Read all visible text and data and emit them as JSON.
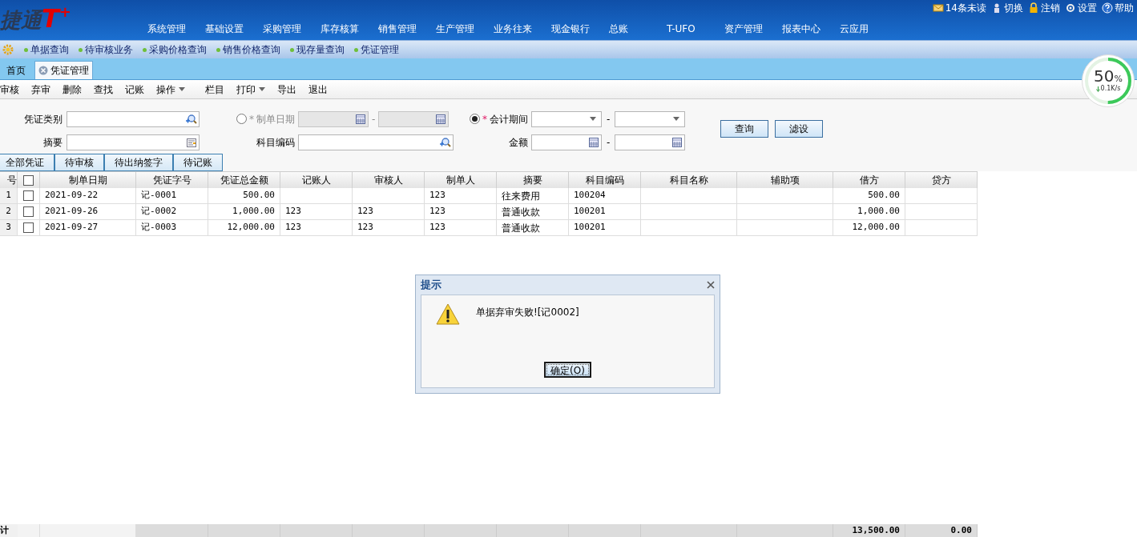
{
  "header": {
    "logo_text": "捷通",
    "logo_mark": "T",
    "logo_plus": "+",
    "nav": [
      "系统管理",
      "基础设置",
      "采购管理",
      "库存核算",
      "销售管理",
      "生产管理",
      "业务往来",
      "现金银行",
      "总账",
      "T-UFO",
      "资产管理",
      "报表中心",
      "云应用"
    ],
    "user_links": [
      {
        "kind": "mail",
        "label": "14条未读"
      },
      {
        "kind": "switch",
        "label": "切换"
      },
      {
        "kind": "lock",
        "label": "注销"
      },
      {
        "kind": "settings",
        "label": "设置"
      },
      {
        "kind": "help",
        "label": "帮助"
      }
    ]
  },
  "quick_links": [
    "单据查询",
    "待审核业务",
    "采购价格查询",
    "销售价格查询",
    "现存量查询",
    "凭证管理"
  ],
  "tabs": [
    {
      "label": "首页",
      "selected": false,
      "closable": false
    },
    {
      "label": "凭证管理",
      "selected": true,
      "closable": true
    }
  ],
  "toolbar": [
    {
      "label": "审核",
      "has_menu": false
    },
    {
      "label": "弃审",
      "has_menu": false
    },
    {
      "label": "删除",
      "has_menu": false
    },
    {
      "label": "查找",
      "has_menu": false
    },
    {
      "label": "记账",
      "has_menu": false
    },
    {
      "label": "操作",
      "has_menu": true
    },
    {
      "label": "栏目",
      "has_menu": false
    },
    {
      "label": "打印",
      "has_menu": true
    },
    {
      "label": "导出",
      "has_menu": false
    },
    {
      "label": "退出",
      "has_menu": false
    }
  ],
  "filters": {
    "voucher_type": {
      "label": "凭证类别"
    },
    "summary": {
      "label": "摘要"
    },
    "make_date": {
      "label": "制单日期",
      "required_mark": "*",
      "selected": false,
      "separator": "-"
    },
    "subject_code": {
      "label": "科目编码"
    },
    "period": {
      "label": "会计期间",
      "required_mark": "*",
      "selected": true,
      "separator": "-"
    },
    "amount": {
      "label": "金额",
      "separator": "-"
    },
    "buttons": [
      "查询",
      "滤设"
    ]
  },
  "view_tabs": [
    "全部凭证",
    "待审核",
    "待出纳签字",
    "待记账"
  ],
  "table": {
    "columns": [
      "号",
      "",
      "制单日期",
      "凭证字号",
      "凭证总金额",
      "记账人",
      "审核人",
      "制单人",
      "摘要",
      "科目编码",
      "科目名称",
      "辅助项",
      "借方",
      "贷方"
    ],
    "all_checked": false,
    "rows": [
      {
        "checked": false,
        "cells": [
          "1",
          "",
          "2021-09-22",
          "记-0001",
          "500.00",
          "",
          "",
          "123",
          "往来费用",
          "100204",
          "",
          "",
          "500.00",
          ""
        ]
      },
      {
        "checked": false,
        "cells": [
          "2",
          "",
          "2021-09-26",
          "记-0002",
          "1,000.00",
          "123",
          "123",
          "123",
          "普通收款",
          "100201",
          "",
          "",
          "1,000.00",
          ""
        ]
      },
      {
        "checked": false,
        "cells": [
          "3",
          "",
          "2021-09-27",
          "记-0003",
          "12,000.00",
          "123",
          "123",
          "123",
          "普通收款",
          "100201",
          "",
          "",
          "12,000.00",
          ""
        ]
      }
    ],
    "totals": {
      "label": "计",
      "debit": "13,500.00",
      "credit": "0.00"
    }
  },
  "dialog": {
    "title": "提示",
    "message": "单据弃审失败![记0002]",
    "button": "确定(O)"
  },
  "speed_widget": {
    "percent": "50",
    "unit": "%",
    "rate": "0.1K/s",
    "level": 0.5
  }
}
